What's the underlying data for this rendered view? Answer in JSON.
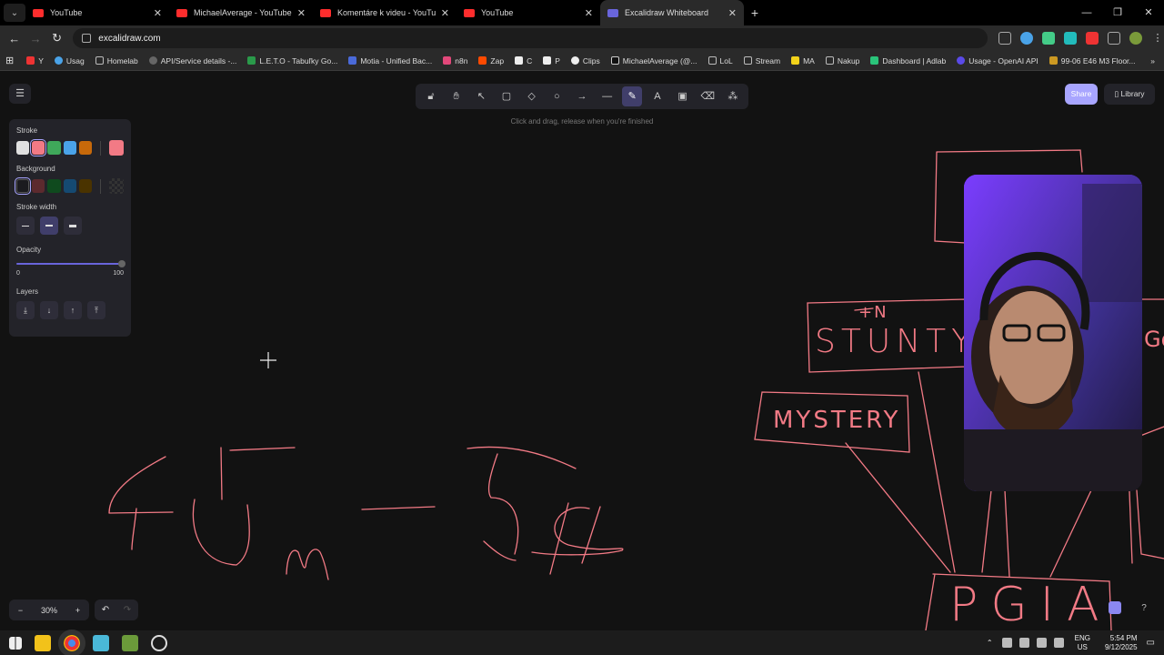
{
  "tabs": [
    {
      "title": "YouTube",
      "active": false
    },
    {
      "title": "MichaelAverage - YouTube",
      "active": false
    },
    {
      "title": "Komentáre k videu - YouTube S",
      "active": false
    },
    {
      "title": "YouTube",
      "active": false
    },
    {
      "title": "Excalidraw Whiteboard",
      "active": true
    }
  ],
  "address": {
    "url": "excalidraw.com"
  },
  "bookmarks": [
    "Y",
    "Usag",
    "Homelab",
    "API/Service details -...",
    "L.E.T.O - Tabuľky Go...",
    "Motia - Unified Bac...",
    "n8n",
    "Zap",
    "C",
    "P",
    "Clips",
    "MichaelAverage (@...",
    "LoL",
    "Stream",
    "MA",
    "Nakup",
    "Dashboard | Adlab",
    "Usage - OpenAI API",
    "99-06 E46 M3 Floor..."
  ],
  "toolbar": {
    "hint": "Click and drag, release when you're finished",
    "share_label": "Share",
    "library_label": "Library"
  },
  "properties": {
    "stroke_label": "Stroke",
    "background_label": "Background",
    "stroke_width_label": "Stroke width",
    "opacity_label": "Opacity",
    "opacity_min": "0",
    "opacity_max": "100",
    "opacity_value": 100,
    "layers_label": "Layers",
    "stroke_colors": [
      "#e0e0e0",
      "#f27a85",
      "#3fa85a",
      "#4aa3e8",
      "#c7690a"
    ],
    "stroke_selected": "#f27a85",
    "background_colors": [
      "transparent",
      "#5c2a2e",
      "#0f4a1e",
      "#154a72",
      "#4a3300"
    ]
  },
  "zoom": {
    "level": "30%"
  },
  "drawing": {
    "texts": [
      "+N",
      "STUNTY",
      "MYSTERY",
      "PGIA",
      "Go"
    ],
    "stroke_color": "#f27a85"
  },
  "taskbar": {
    "lang_top": "ENG",
    "lang_bottom": "US",
    "time": "5:54 PM",
    "date": "9/12/2025"
  }
}
